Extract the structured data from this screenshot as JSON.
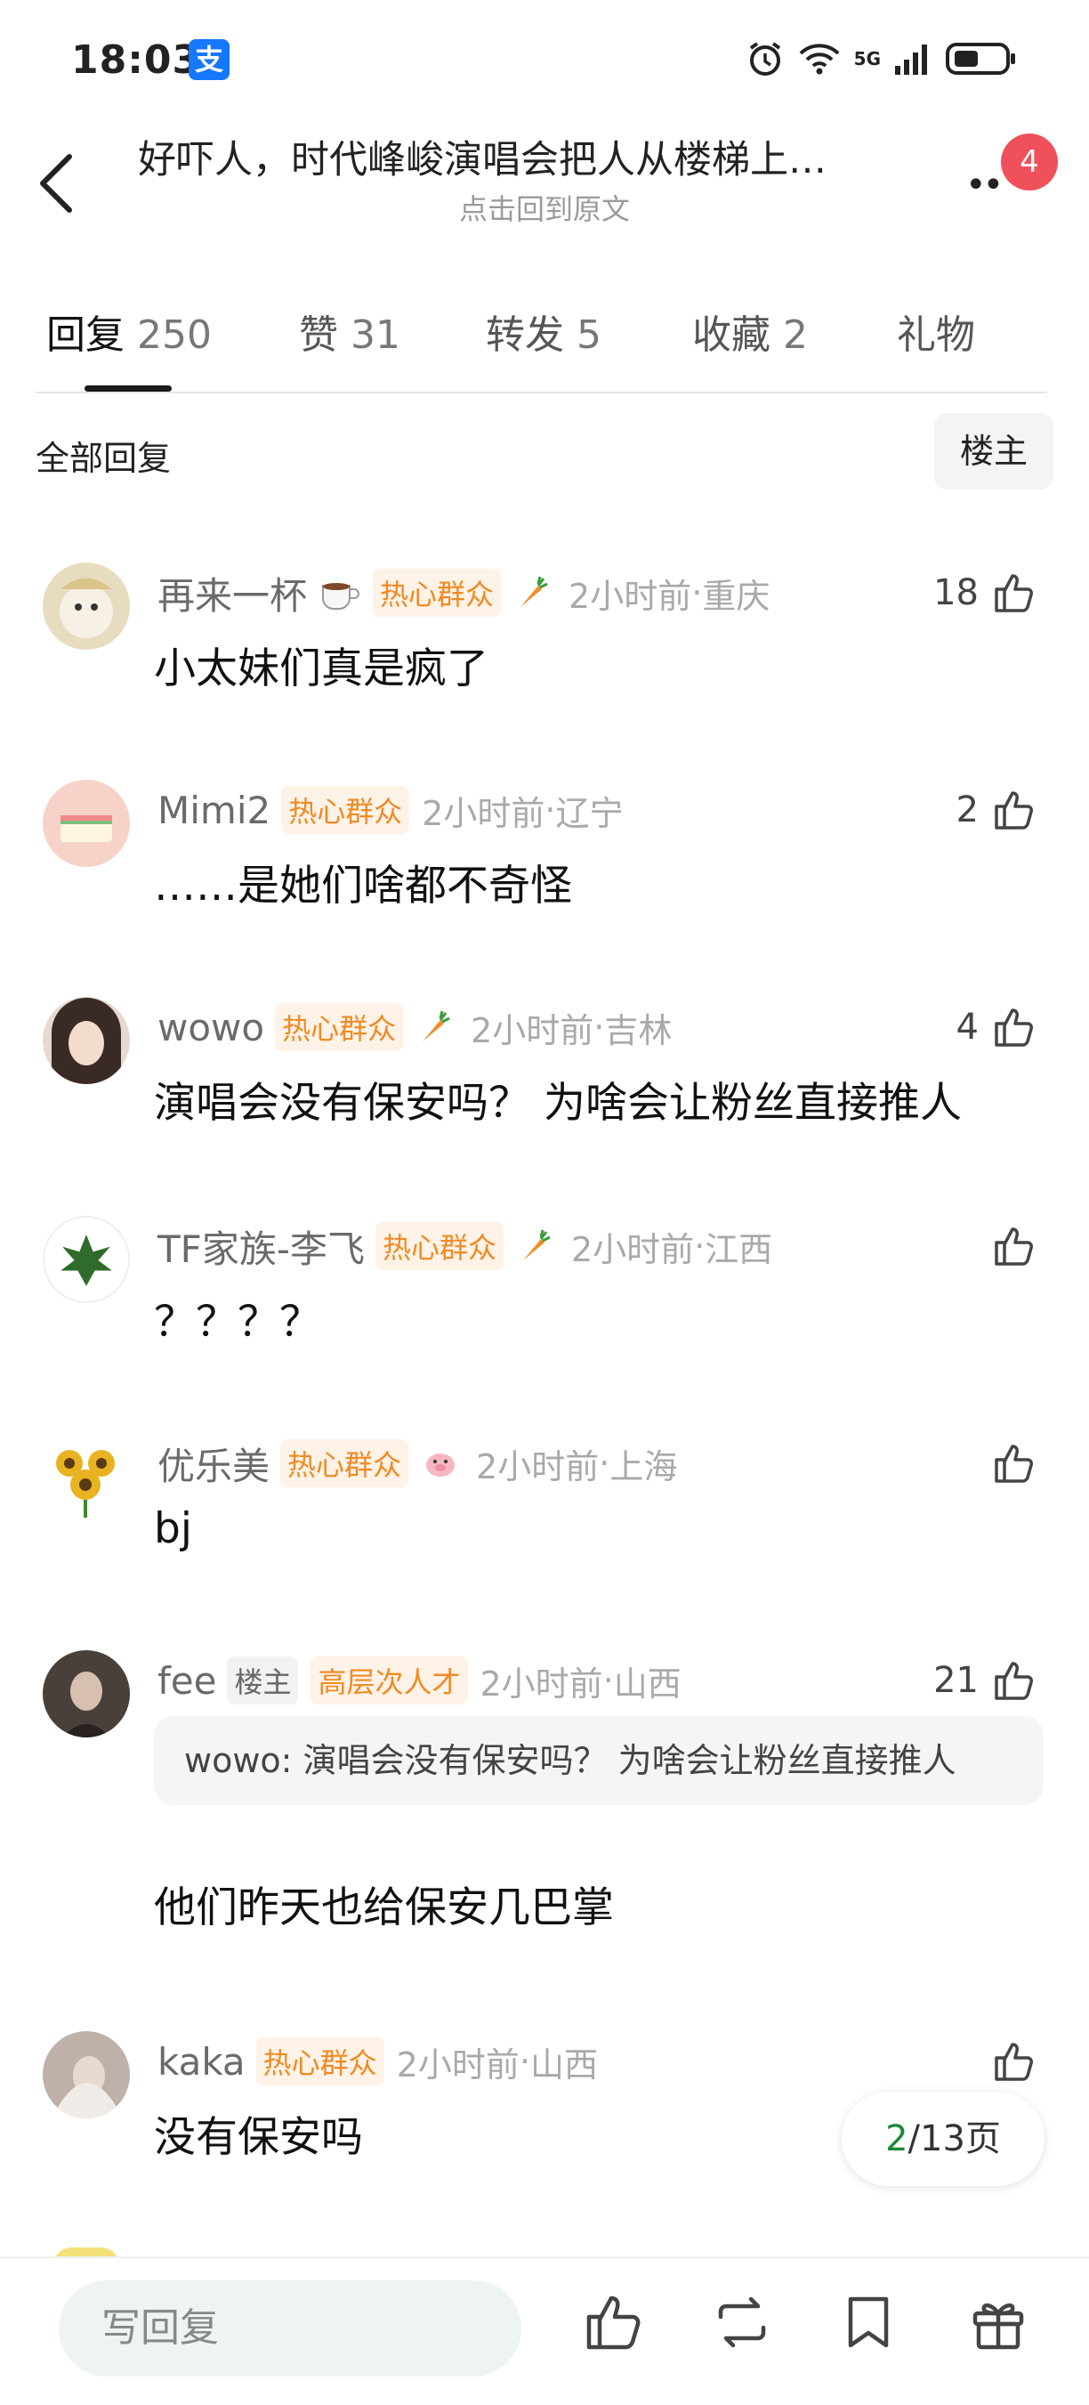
{
  "status_bar": {
    "time": "18:03",
    "alipay_icon_label": "支",
    "network": "5G"
  },
  "header": {
    "title": "好吓人，时代峰峻演唱会把人从楼梯上…",
    "subtitle": "点击回到原文",
    "more_icon": "more-icon",
    "notification_count": "4"
  },
  "tabs": [
    {
      "label": "回复",
      "count": "250",
      "active": true
    },
    {
      "label": "赞",
      "count": "31"
    },
    {
      "label": "转发",
      "count": "5"
    },
    {
      "label": "收藏",
      "count": "2"
    },
    {
      "label": "礼物",
      "count": ""
    }
  ],
  "filter": {
    "label": "全部回复",
    "owner_button": "楼主"
  },
  "comments": [
    {
      "username": "再来一杯",
      "badge": "热心群众",
      "icon": "carrot-icon",
      "time": "2小时前",
      "location": "重庆",
      "likes": "18",
      "text": "小太妹们真是疯了",
      "avatar_color": "#d9c48a"
    },
    {
      "username": "Mimi2",
      "badge": "热心群众",
      "time": "2小时前",
      "location": "辽宁",
      "likes": "2",
      "text": "……是她们啥都不奇怪",
      "avatar_color": "#f3c2b6"
    },
    {
      "username": "wowo",
      "badge": "热心群众",
      "icon": "carrot-icon",
      "time": "2小时前",
      "location": "吉林",
      "likes": "4",
      "text": "演唱会没有保安吗？ 为啥会让粉丝直接推人",
      "avatar_color": "#6b4a3a"
    },
    {
      "username": "TF家族-李飞",
      "badge": "热心群众",
      "icon": "carrot-icon",
      "time": "2小时前",
      "location": "江西",
      "likes": "",
      "text": "？？？？",
      "avatar_color": "#2f6b2a"
    },
    {
      "username": "优乐美",
      "badge": "热心群众",
      "icon": "pig-icon",
      "time": "2小时前",
      "location": "上海",
      "likes": "",
      "text": "bj",
      "avatar_color": "#e8b320"
    },
    {
      "username": "fee",
      "owner_tag": "楼主",
      "badge": "高层次人才",
      "time": "2小时前",
      "location": "山西",
      "likes": "21",
      "quote": "wowo: 演唱会没有保安吗？ 为啥会让粉丝直接推人",
      "text": "他们昨天也给保安几巴掌",
      "avatar_color": "#3d3532"
    },
    {
      "username": "kaka",
      "badge": "热心群众",
      "time": "2小时前",
      "location": "山西",
      "likes": "",
      "text": "没有保安吗",
      "avatar_color": "#8c7a74"
    }
  ],
  "pager": {
    "current": "2",
    "rest": "/13页"
  },
  "bottom_bar": {
    "reply_placeholder": "写回复",
    "icons": [
      "like-icon",
      "repost-icon",
      "bookmark-icon",
      "gift-icon"
    ]
  },
  "colors": {
    "accent_badge": "#f0505a",
    "tag_text": "#f08a24",
    "tag_bg": "#fff2e6",
    "pager_current": "#1a8a3a"
  }
}
